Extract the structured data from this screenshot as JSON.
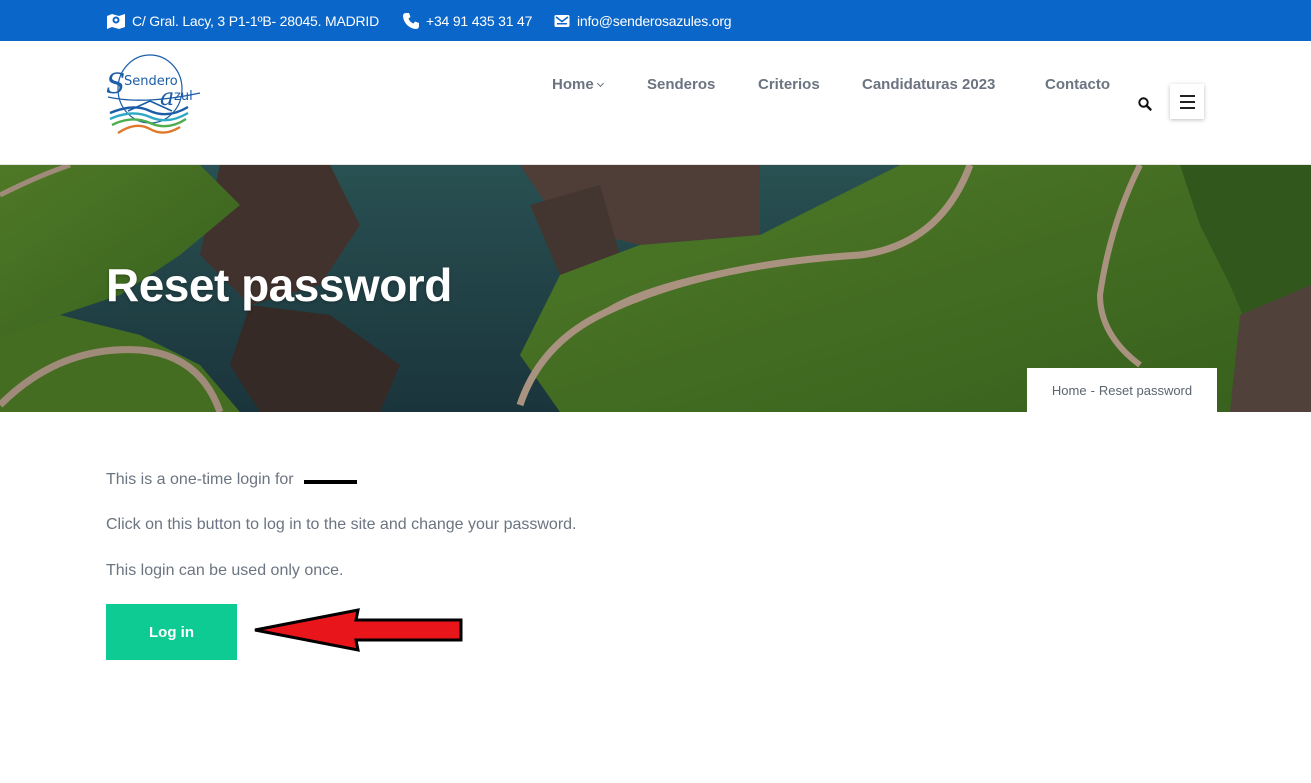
{
  "topbar": {
    "address": "C/ Gral. Lacy, 3 P1-1ºB- 28045. MADRID",
    "phone": "+34 91 435 31 47",
    "email": "info@senderosazules.org",
    "address_icon": "map-icon",
    "phone_icon": "phone-icon",
    "email_icon": "mail-icon",
    "color": "#0a66c8"
  },
  "logo": {
    "word1": "Sendero",
    "word2": "zul"
  },
  "nav": {
    "items": [
      "Home",
      "Senderos",
      "Criterios",
      "Candidaturas 2023",
      "Contacto"
    ]
  },
  "hero": {
    "title": "Reset password"
  },
  "breadcrumb": {
    "home": "Home",
    "separator": "-",
    "current": "Reset password"
  },
  "content": {
    "line1": "This is a one-time login for",
    "line2": "Click on this button to log in to the site and change your password.",
    "line3": "This login can be used only once.",
    "login_label": "Log in",
    "accent": "#0ecb93"
  },
  "annotation": {
    "arrow_color": "#e8151b"
  }
}
